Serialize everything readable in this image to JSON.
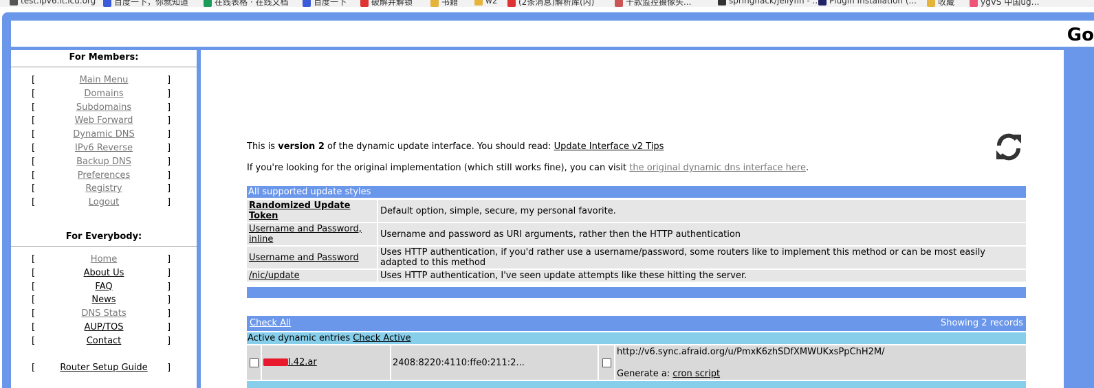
{
  "bookmarks": [
    "test.ipv6.lt.icu.org",
    "百度一下，你就知道",
    "在线表格 · 在线文档",
    "百度一下",
    "破解并解锁",
    "书籍",
    "w2",
    "(2条消息)解析库(内)",
    "千款监控摄像头...",
    "springhack/jellyfin - ...",
    "Plugin Installation (...",
    "收藏",
    "ygVS 中国ug…"
  ],
  "header": {
    "logo": "Go"
  },
  "sidebar": {
    "members_title": "For Members:",
    "members": [
      {
        "label": "Main Menu",
        "grey": true
      },
      {
        "label": "Domains",
        "grey": true
      },
      {
        "label": "Subdomains",
        "grey": true
      },
      {
        "label": "Web Forward",
        "grey": true
      },
      {
        "label": "Dynamic DNS",
        "grey": true
      },
      {
        "label": "IPv6 Reverse",
        "grey": true
      },
      {
        "label": "Backup DNS",
        "grey": true
      },
      {
        "label": "Preferences",
        "grey": true
      },
      {
        "label": "Registry",
        "grey": true
      },
      {
        "label": "Logout",
        "grey": true
      }
    ],
    "everybody_title": "For Everybody:",
    "everybody": [
      {
        "label": "Home",
        "grey": true
      },
      {
        "label": "About Us",
        "grey": false
      },
      {
        "label": "FAQ",
        "grey": false
      },
      {
        "label": "News",
        "grey": false
      },
      {
        "label": "DNS Stats",
        "grey": true
      },
      {
        "label": "AUP/TOS",
        "grey": false
      },
      {
        "label": "Contact",
        "grey": false
      }
    ],
    "router_guide": "Router Setup Guide",
    "bracket_left": "[",
    "bracket_right": "]"
  },
  "main": {
    "intro_pre": "This is ",
    "intro_bold": "version 2",
    "intro_mid": " of the dynamic update interface. You should read: ",
    "intro_link": "Update Interface v2 Tips",
    "orig_pre": "If you're looking for the original implementation (which still works fine), you can visit ",
    "orig_link": "the original dynamic dns interface here",
    "orig_post": ".",
    "refresh_icon": "refresh-icon",
    "styles_header": "All supported update styles",
    "styles": [
      {
        "name": "Randomized Update Token",
        "desc": "Default option, simple, secure, my personal favorite.",
        "bold": true
      },
      {
        "name": "Username and Password, inline",
        "desc": "Username and password as URI arguments, rather then the HTTP authentication",
        "bold": false
      },
      {
        "name": "Username and Password",
        "desc": "Uses HTTP authentication, if you'd rather use a username/password, some routers like to implement this method or can be most easily adapted to this method",
        "bold": false
      },
      {
        "name": "/nic/update",
        "desc": "Uses HTTP authentication, I've seen update attempts like these hitting the server.",
        "bold": false
      }
    ],
    "check_all": "Check All",
    "showing": "Showing 2 records",
    "active_label": "Active dynamic entries ",
    "check_active": "Check Active",
    "entry": {
      "domain_suffix": "l.42.ar",
      "ip": "2408:8220:4110:ffe0:211:2...",
      "url": "http://v6.sync.afraid.org/u/PmxK6zhSDfXMWUKxsPpChH2M/",
      "generate_pre": "Generate a: ",
      "generate_link": "cron script"
    }
  },
  "colors": {
    "frame": "#6b97ea",
    "active_row": "#87ceeb",
    "cell": "#e6e6e6"
  }
}
